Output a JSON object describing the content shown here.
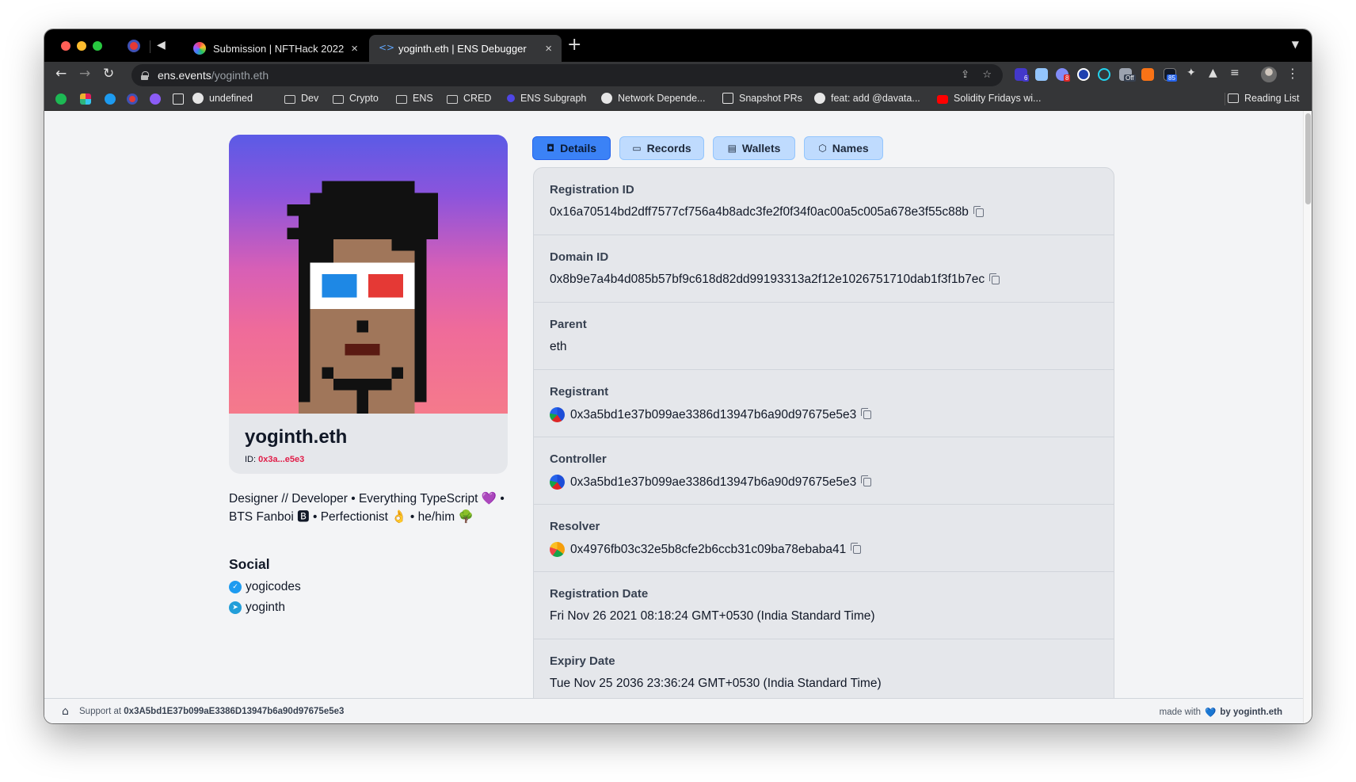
{
  "browser": {
    "tabs": [
      {
        "label": "Submission | NFTHack 2022",
        "active": false
      },
      {
        "label": "yoginth.eth | ENS Debugger",
        "active": true
      }
    ],
    "url_host": "ens.events",
    "url_path": "/yoginth.eth",
    "bookmarks": [
      {
        "label": "undefined",
        "icon": "github-icon"
      },
      {
        "label": "Dev",
        "icon": "folder-icon"
      },
      {
        "label": "Crypto",
        "icon": "folder-icon"
      },
      {
        "label": "ENS",
        "icon": "folder-icon"
      },
      {
        "label": "CRED",
        "icon": "folder-icon"
      },
      {
        "label": "ENS Subgraph",
        "icon": "graph-icon"
      },
      {
        "label": "Network Depende...",
        "icon": "github-icon"
      },
      {
        "label": "Snapshot PRs",
        "icon": "notion-icon"
      },
      {
        "label": "feat: add @davata...",
        "icon": "github-icon"
      },
      {
        "label": "Solidity Fridays wi...",
        "icon": "youtube-icon"
      }
    ],
    "reading_list": "Reading List",
    "extension_badges": [
      "6",
      "8",
      "Off",
      "85"
    ]
  },
  "profile": {
    "name": "yoginth.eth",
    "id_label": "ID:",
    "id_value": "0x3a...e5e3",
    "bio": "Designer // Developer • Everything TypeScript 💜 • BTS Fanboi 🅱 • Perfectionist 👌 • he/him 🌳",
    "social_heading": "Social",
    "social": [
      {
        "label": "yogicodes",
        "icon": "twitter-icon"
      },
      {
        "label": "yoginth",
        "icon": "telegram-icon"
      }
    ]
  },
  "tabs": [
    {
      "label": "Details",
      "icon": "camera-icon",
      "active": true
    },
    {
      "label": "Records",
      "icon": "folder-icon",
      "active": false
    },
    {
      "label": "Wallets",
      "icon": "wallet-icon",
      "active": false
    },
    {
      "label": "Names",
      "icon": "cube-icon",
      "active": false
    }
  ],
  "details": [
    {
      "label": "Registration ID",
      "value": "0x16a70514bd2dff7577cf756a4b8adc3fe2f0f34f0ac00a5c005a678e3f55c88b",
      "copy": true
    },
    {
      "label": "Domain ID",
      "value": "0x8b9e7a4b4d085b57bf9c618d82dd99193313a2f12e1026751710dab1f3f1b7ec",
      "copy": true
    },
    {
      "label": "Parent",
      "value": "eth",
      "copy": false
    },
    {
      "label": "Registrant",
      "value": "0x3a5bd1e37b099ae3386d13947b6a90d97675e5e3",
      "copy": true,
      "blob": "#1d4ed8"
    },
    {
      "label": "Controller",
      "value": "0x3a5bd1e37b099ae3386d13947b6a90d97675e5e3",
      "copy": true,
      "blob": "#1d4ed8"
    },
    {
      "label": "Resolver",
      "value": "0x4976fb03c32e5b8cfe2b6ccb31c09ba78ebaba41",
      "copy": true,
      "blob": "#f59e0b"
    },
    {
      "label": "Registration Date",
      "value": "Fri Nov 26 2021 08:18:24 GMT+0530 (India Standard Time)",
      "copy": false
    },
    {
      "label": "Expiry Date",
      "value": "Tue Nov 25 2036 23:36:24 GMT+0530 (India Standard Time)",
      "copy": false
    }
  ],
  "footer": {
    "support_label": "Support at",
    "support_address": "0x3A5bd1E37b099aE3386D13947b6a90d97675e5e3",
    "made_with": "made with",
    "heart": "💙",
    "by": "by yoginth.eth"
  },
  "colors": {
    "primary_tab": "#3b82f6",
    "idle_tab": "#bfdbfe",
    "id_accent": "#e11d48"
  }
}
